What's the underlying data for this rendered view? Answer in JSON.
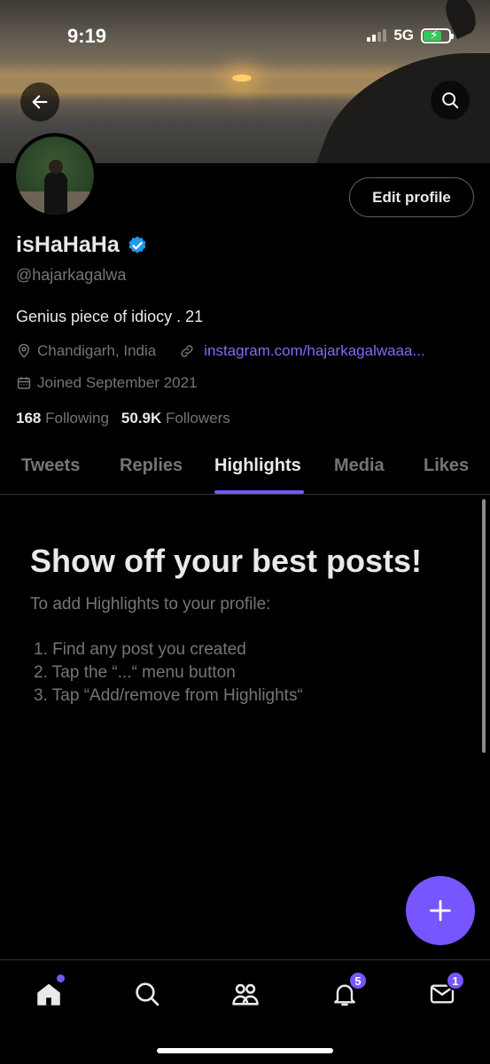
{
  "status_bar": {
    "time": "9:19",
    "network": "5G"
  },
  "profile": {
    "name": "isHaHaHa",
    "handle": "@hajarkagalwa",
    "bio": "Genius piece of idiocy . 21",
    "location": "Chandigarh, India",
    "website": "instagram.com/hajarkagalwaaa...",
    "joined": "Joined September 2021",
    "following_count": "168",
    "following_label": "Following",
    "followers_count": "50.9K",
    "followers_label": "Followers",
    "edit_button": "Edit profile"
  },
  "tabs": [
    {
      "label": "Tweets",
      "active": false
    },
    {
      "label": "Replies",
      "active": false
    },
    {
      "label": "Highlights",
      "active": true
    },
    {
      "label": "Media",
      "active": false
    },
    {
      "label": "Likes",
      "active": false
    }
  ],
  "highlights_empty": {
    "title": "Show off your best posts!",
    "subtitle": "To add Highlights to your profile:",
    "steps": [
      "1. Find any post you created",
      "2. Tap the “...“ menu button",
      "3. Tap “Add/remove from Highlights“"
    ]
  },
  "bottom_nav": {
    "notifications_badge": "5",
    "messages_badge": "1"
  },
  "colors": {
    "accent": "#7856ff",
    "verified": "#1d9bf0",
    "link": "#7e6cf5"
  }
}
